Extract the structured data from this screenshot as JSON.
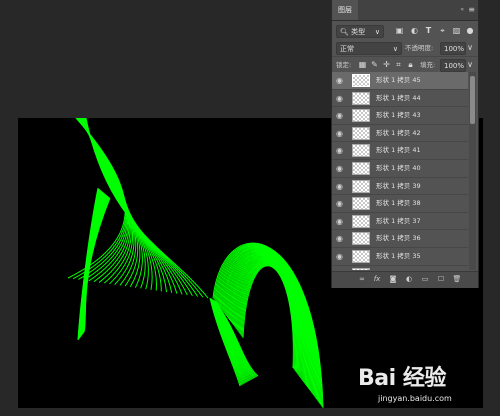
{
  "panel": {
    "tab": "图层",
    "collapse_icon": "«",
    "menu_icon": "≡",
    "filter": {
      "label": "类型",
      "icons": [
        "image-filter-icon",
        "adjustment-filter-icon",
        "type-filter-icon",
        "shape-filter-icon",
        "smartobject-filter-icon"
      ]
    },
    "blend": {
      "mode": "正常",
      "opacity_label": "不透明度:",
      "opacity_value": "100%"
    },
    "lock": {
      "label": "锁定:",
      "fill_label": "填充:",
      "fill_value": "100%"
    },
    "layers": [
      {
        "name": "形状 1 拷贝 45",
        "active": true
      },
      {
        "name": "形状 1 拷贝 44",
        "active": false
      },
      {
        "name": "形状 1 拷贝 43",
        "active": false
      },
      {
        "name": "形状 1 拷贝 42",
        "active": false
      },
      {
        "name": "形状 1 拷贝 41",
        "active": false
      },
      {
        "name": "形状 1 拷贝 40",
        "active": false
      },
      {
        "name": "形状 1 拷贝 39",
        "active": false
      },
      {
        "name": "形状 1 拷贝 38",
        "active": false
      },
      {
        "name": "形状 1 拷贝 37",
        "active": false
      },
      {
        "name": "形状 1 拷贝 36",
        "active": false
      },
      {
        "name": "形状 1 拷贝 35",
        "active": false
      },
      {
        "name": "",
        "active": false
      }
    ],
    "bottom_icons": [
      "link-icon",
      "fx-icon",
      "mask-icon",
      "adjustment-icon",
      "group-icon",
      "new-layer-icon",
      "trash-icon"
    ]
  },
  "canvas": {
    "background": "#000000",
    "stroke_color": "#00ff00"
  },
  "watermark": {
    "logo_text": "Bai  经验",
    "url": "jingyan.baidu.com"
  }
}
